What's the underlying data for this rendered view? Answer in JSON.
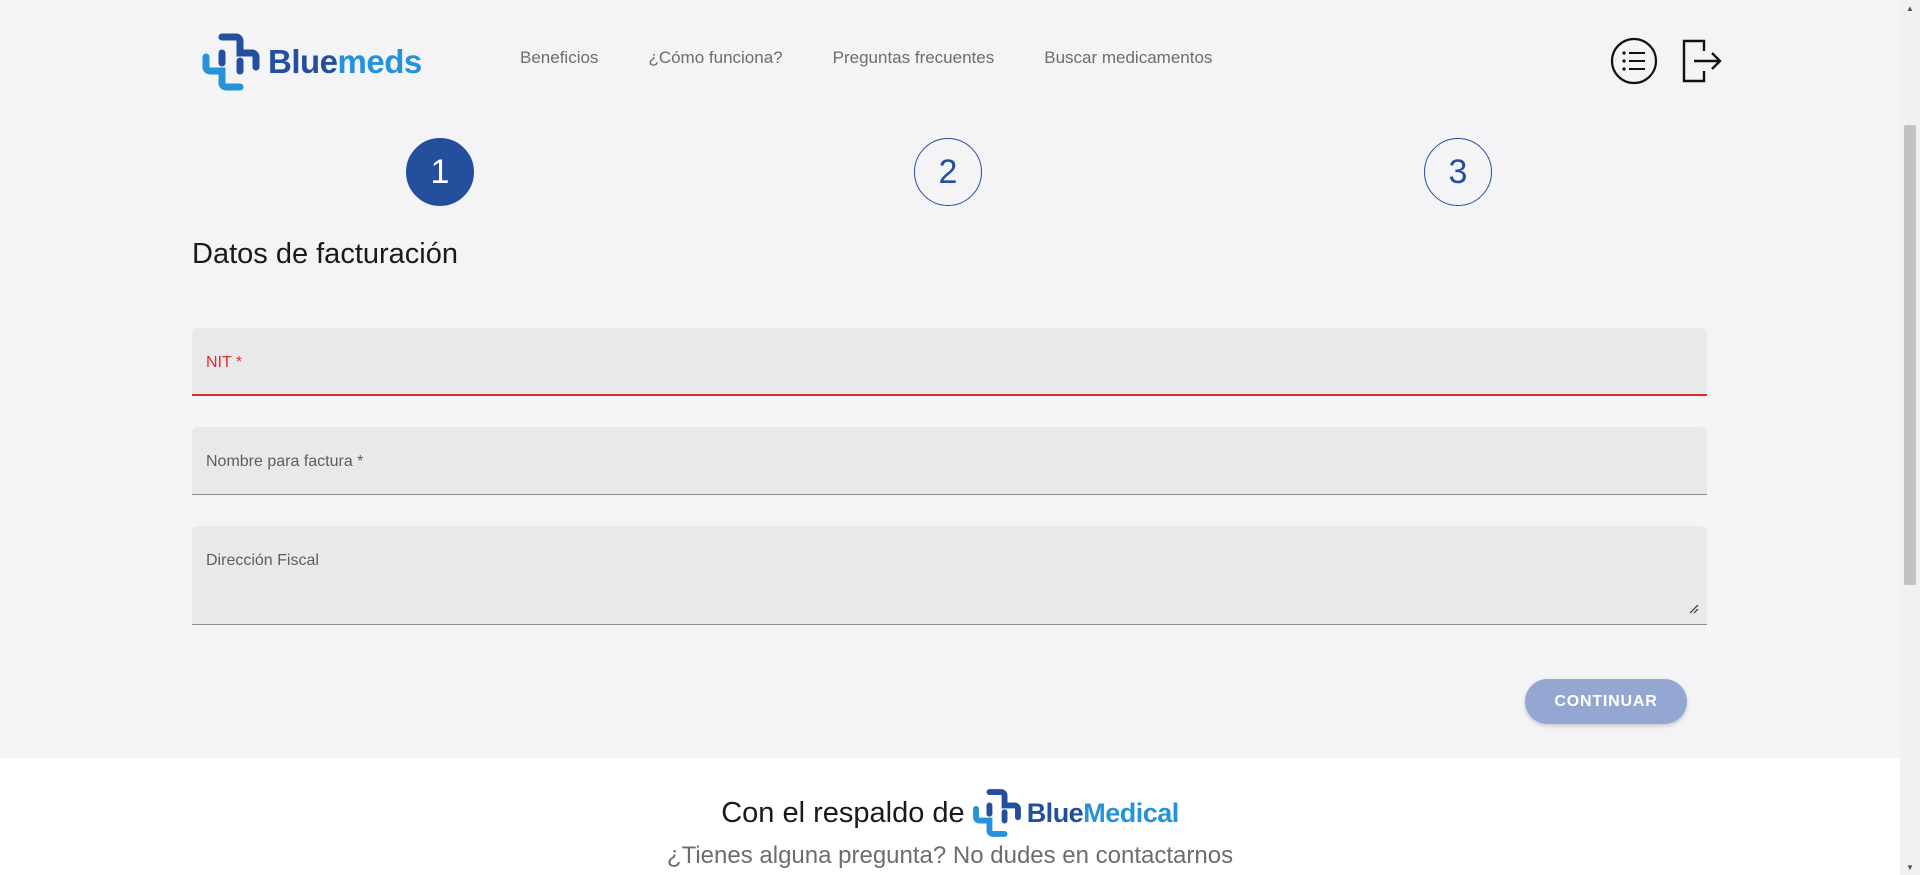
{
  "header": {
    "logo": {
      "part1": "Blue",
      "part2": "meds"
    },
    "nav": [
      {
        "label": "Beneficios"
      },
      {
        "label": "¿Cómo funciona?"
      },
      {
        "label": "Preguntas frecuentes"
      },
      {
        "label": "Buscar medicamentos"
      }
    ],
    "icons": [
      "list-icon",
      "logout-icon"
    ]
  },
  "stepper": {
    "steps": [
      {
        "label": "1",
        "active": true
      },
      {
        "label": "2",
        "active": false
      },
      {
        "label": "3",
        "active": false
      }
    ]
  },
  "form": {
    "title": "Datos de facturación",
    "fields": {
      "nit": {
        "label": "NIT *",
        "value": ""
      },
      "nombre": {
        "label": "Nombre para factura *",
        "value": ""
      },
      "direccion": {
        "label": "Dirección Fiscal",
        "value": ""
      }
    },
    "continue_label": "CONTINUAR"
  },
  "footer": {
    "backed_text": "Con el respaldo de",
    "logo": {
      "part1": "Blue",
      "part2": "Medical"
    },
    "question": "¿Tienes alguna pregunta? No dudes en contactarnos"
  },
  "colors": {
    "primary": "#234f9c",
    "accent": "#2592d9",
    "error": "#d9302a",
    "button_disabled": "#93a7d2",
    "background": "#f4f4f7"
  }
}
